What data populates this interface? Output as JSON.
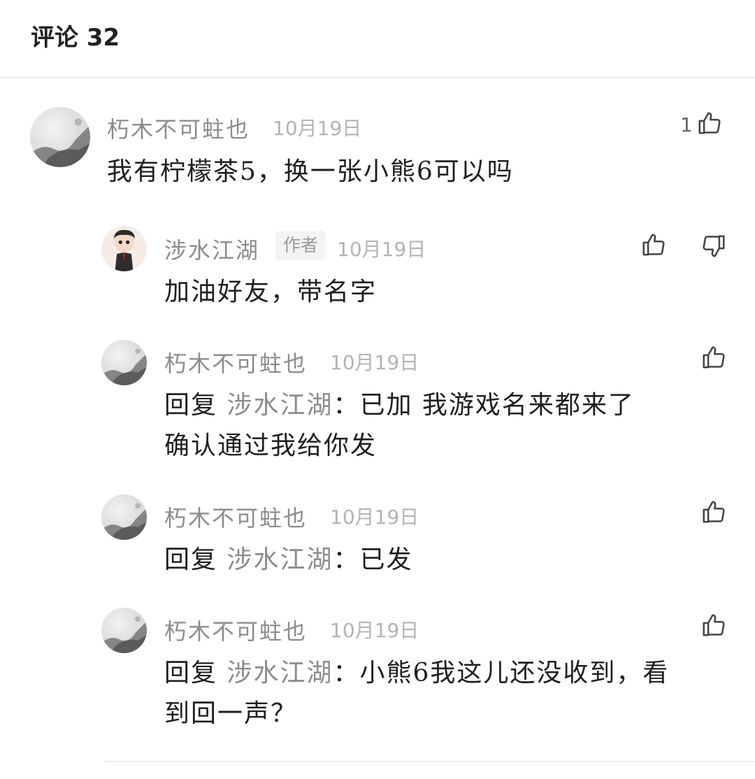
{
  "header": {
    "title": "评论 32"
  },
  "comments": [
    {
      "user": "朽木不可蛀也",
      "date": "10月19日",
      "like_count": "1",
      "text": "我有柠檬茶5，换一张小熊6可以吗"
    },
    {
      "user": "涉水江湖",
      "badge": "作者",
      "date": "10月19日",
      "text": "加油好友，带名字"
    },
    {
      "user": "朽木不可蛀也",
      "date": "10月19日",
      "reply_prefix": "回复",
      "reply_to": "涉水江湖",
      "text_line1": "：已加 我游戏名来都来了",
      "text_line2": "确认通过我给你发"
    },
    {
      "user": "朽木不可蛀也",
      "date": "10月19日",
      "reply_prefix": "回复",
      "reply_to": "涉水江湖",
      "text_line1": "：已发"
    },
    {
      "user": "朽木不可蛀也",
      "date": "10月19日",
      "reply_prefix": "回复",
      "reply_to": "涉水江湖",
      "text_line1": "：小熊6我这儿还没收到，看",
      "text_line2": "到回一声？"
    }
  ],
  "icons": {
    "like": "thumbs-up-icon",
    "dislike": "thumbs-down-icon"
  }
}
